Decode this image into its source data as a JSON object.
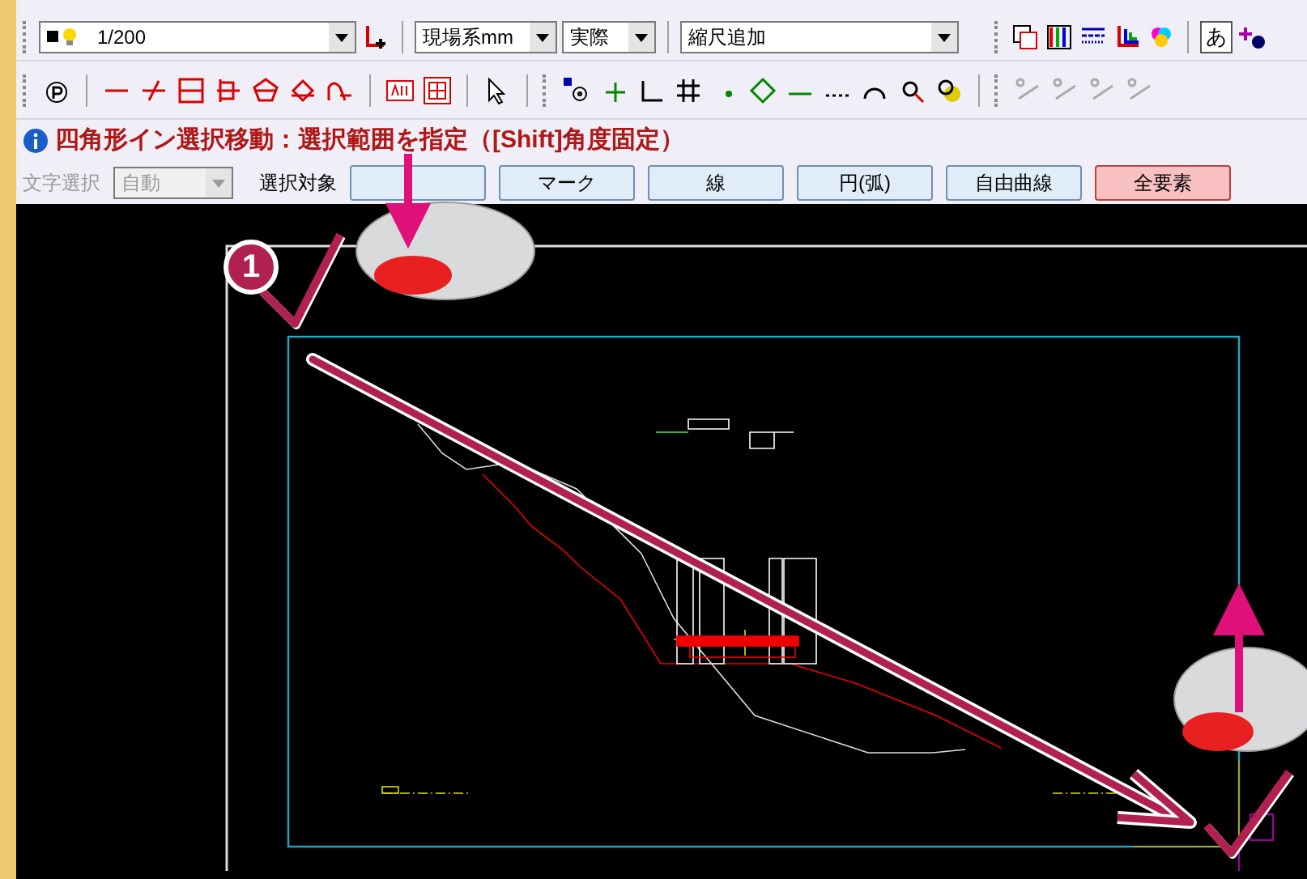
{
  "toolbar": {
    "layer_combo": {
      "value": "1/200"
    },
    "coord_combo": {
      "value": "現場系mm"
    },
    "size_combo": {
      "value": "実際"
    },
    "scale_combo": {
      "value": "縮尺追加"
    },
    "text_button": "あ"
  },
  "message": "四角形イン選択移動：選択範囲を指定（[Shift]角度固定）",
  "selection_bar": {
    "text_select_label": "文字選択",
    "text_select_combo": {
      "value": "自動",
      "disabled": true
    },
    "target_label": "選択対象",
    "buttons": [
      {
        "kind": "covered",
        "selected": false
      },
      {
        "kind": "text",
        "label": "マーク",
        "selected": false
      },
      {
        "kind": "text",
        "label": "線",
        "selected": false
      },
      {
        "kind": "text",
        "label": "円(弧)",
        "selected": false
      },
      {
        "kind": "text",
        "label": "自由曲線",
        "selected": false
      },
      {
        "kind": "text",
        "label": "全要素",
        "selected": true
      }
    ]
  },
  "step_badge": "1"
}
